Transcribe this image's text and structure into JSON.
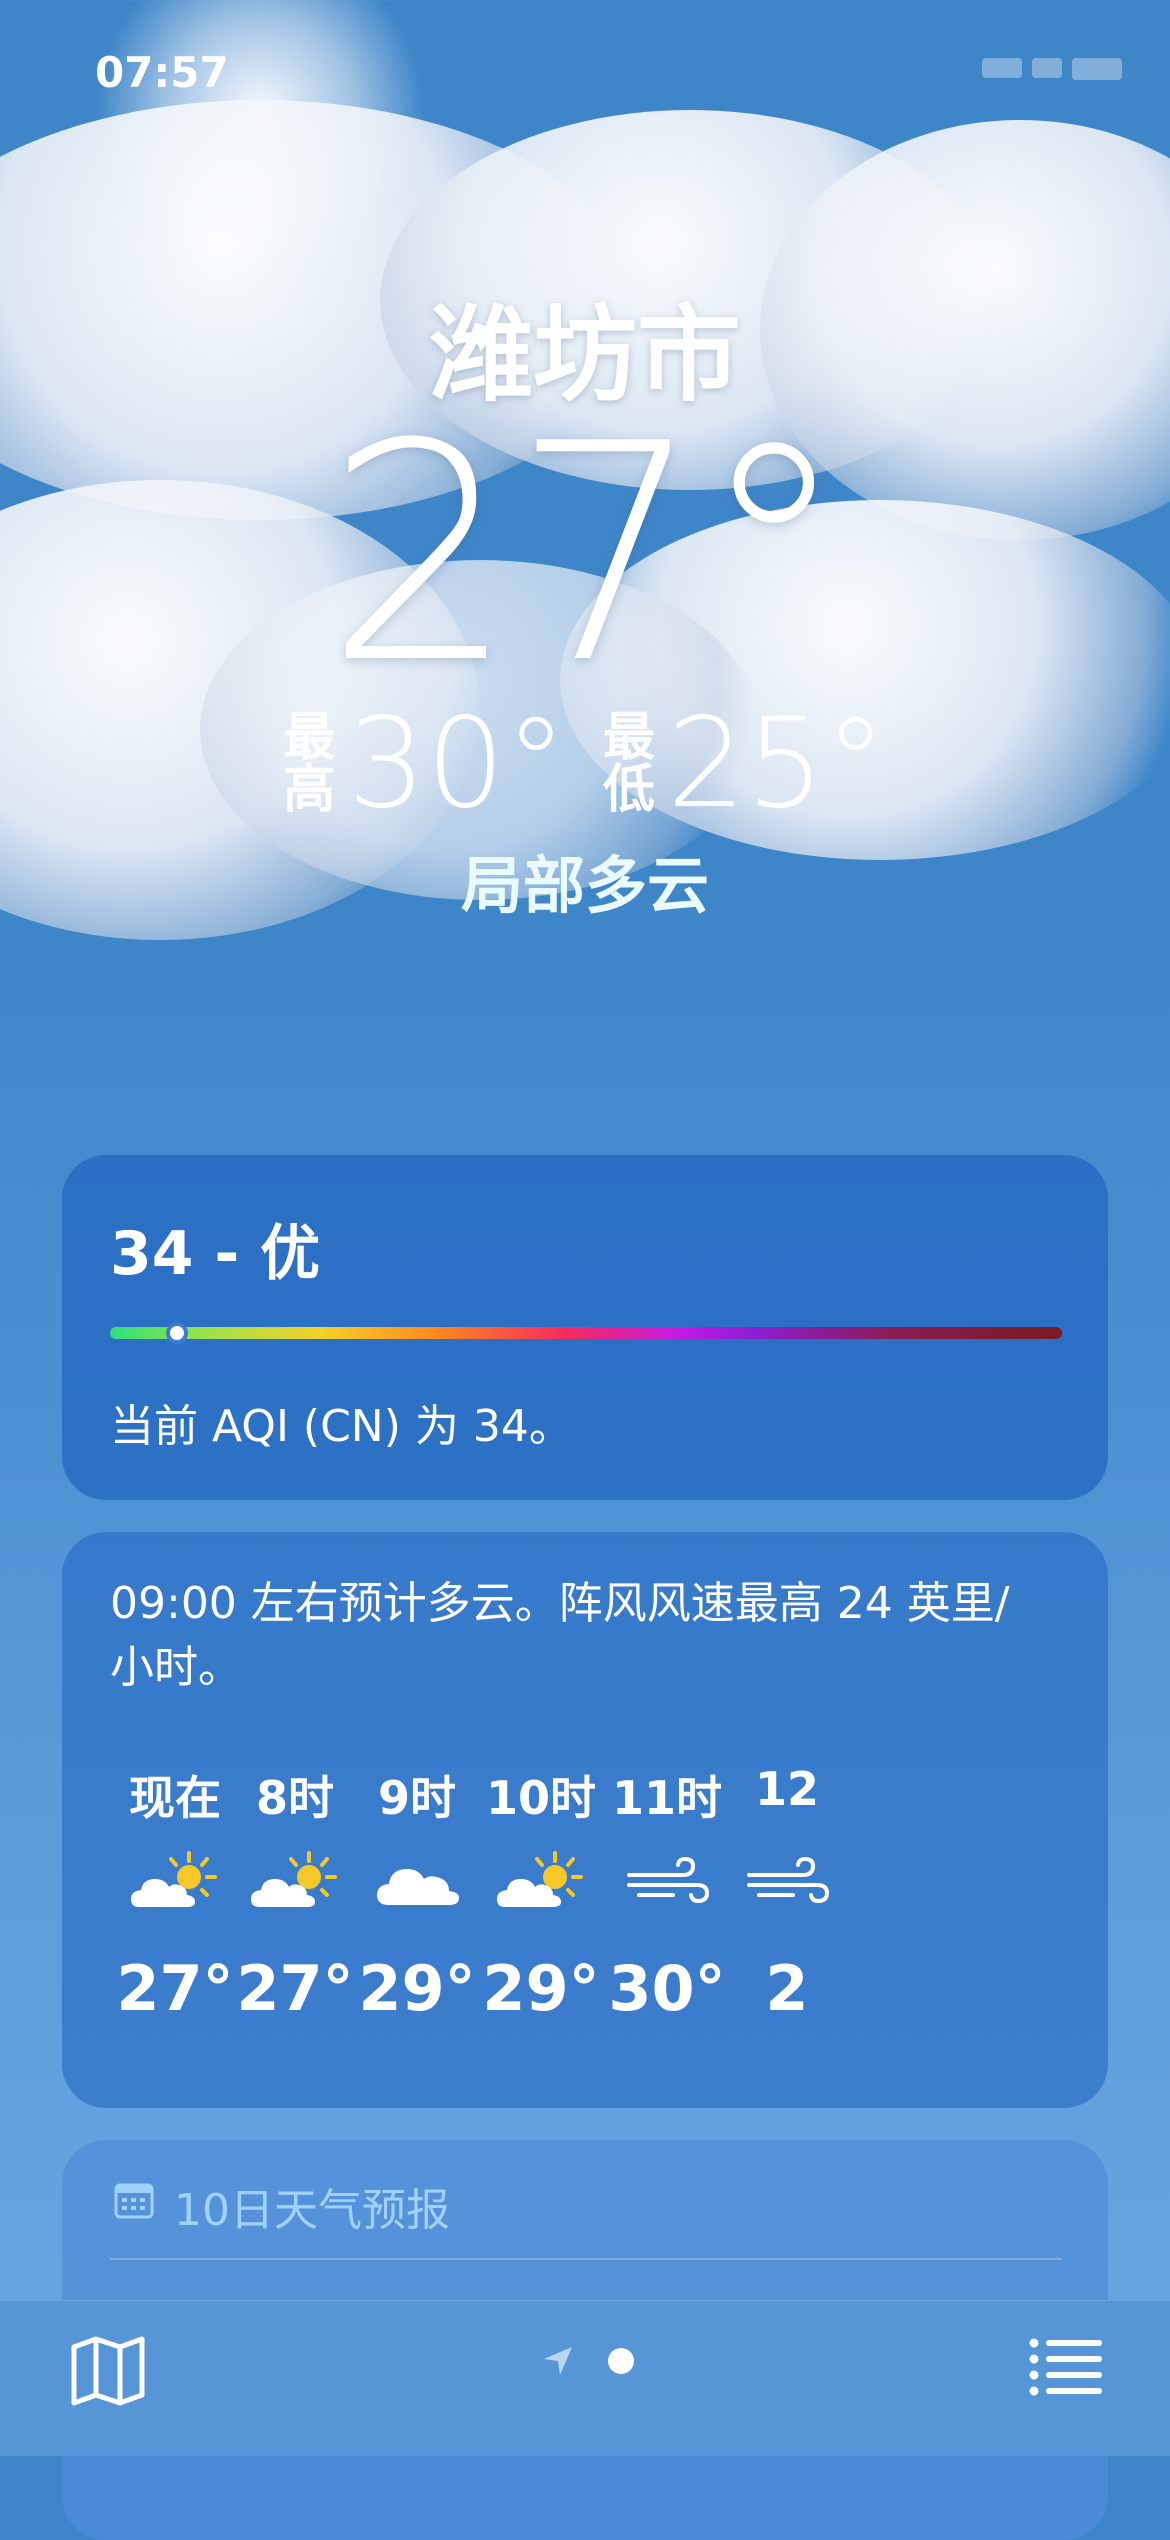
{
  "status": {
    "time": "07:57"
  },
  "header": {
    "city": "潍坊市",
    "temperature": "27°",
    "high_label": "最高",
    "high": "30°",
    "low_label": "最低",
    "low": "25°",
    "condition": "局部多云"
  },
  "aqi": {
    "title": "34 - 优",
    "value": 34,
    "description": "当前 AQI (CN) 为 34。"
  },
  "hourly": {
    "summary": "09:00 左右预计多云。阵风风速最高 24 英里/小时。",
    "hours": [
      {
        "label": "现在",
        "icon": "partly-sunny-icon",
        "temp": "27°"
      },
      {
        "label": "8时",
        "icon": "partly-sunny-icon",
        "temp": "27°"
      },
      {
        "label": "9时",
        "icon": "cloud-icon",
        "temp": "29°"
      },
      {
        "label": "10时",
        "icon": "partly-sunny-icon",
        "temp": "29°"
      },
      {
        "label": "11时",
        "icon": "wind-icon",
        "temp": "30°"
      },
      {
        "label": "12",
        "icon": "wind-icon",
        "temp": "2"
      }
    ]
  },
  "forecast": {
    "title": "10日天气预报",
    "icon": "calendar-icon"
  },
  "tabbar": {
    "left_icon": "map-icon",
    "center_icons": [
      "location-arrow-icon",
      "page-dot-icon"
    ],
    "right_icon": "list-icon"
  }
}
